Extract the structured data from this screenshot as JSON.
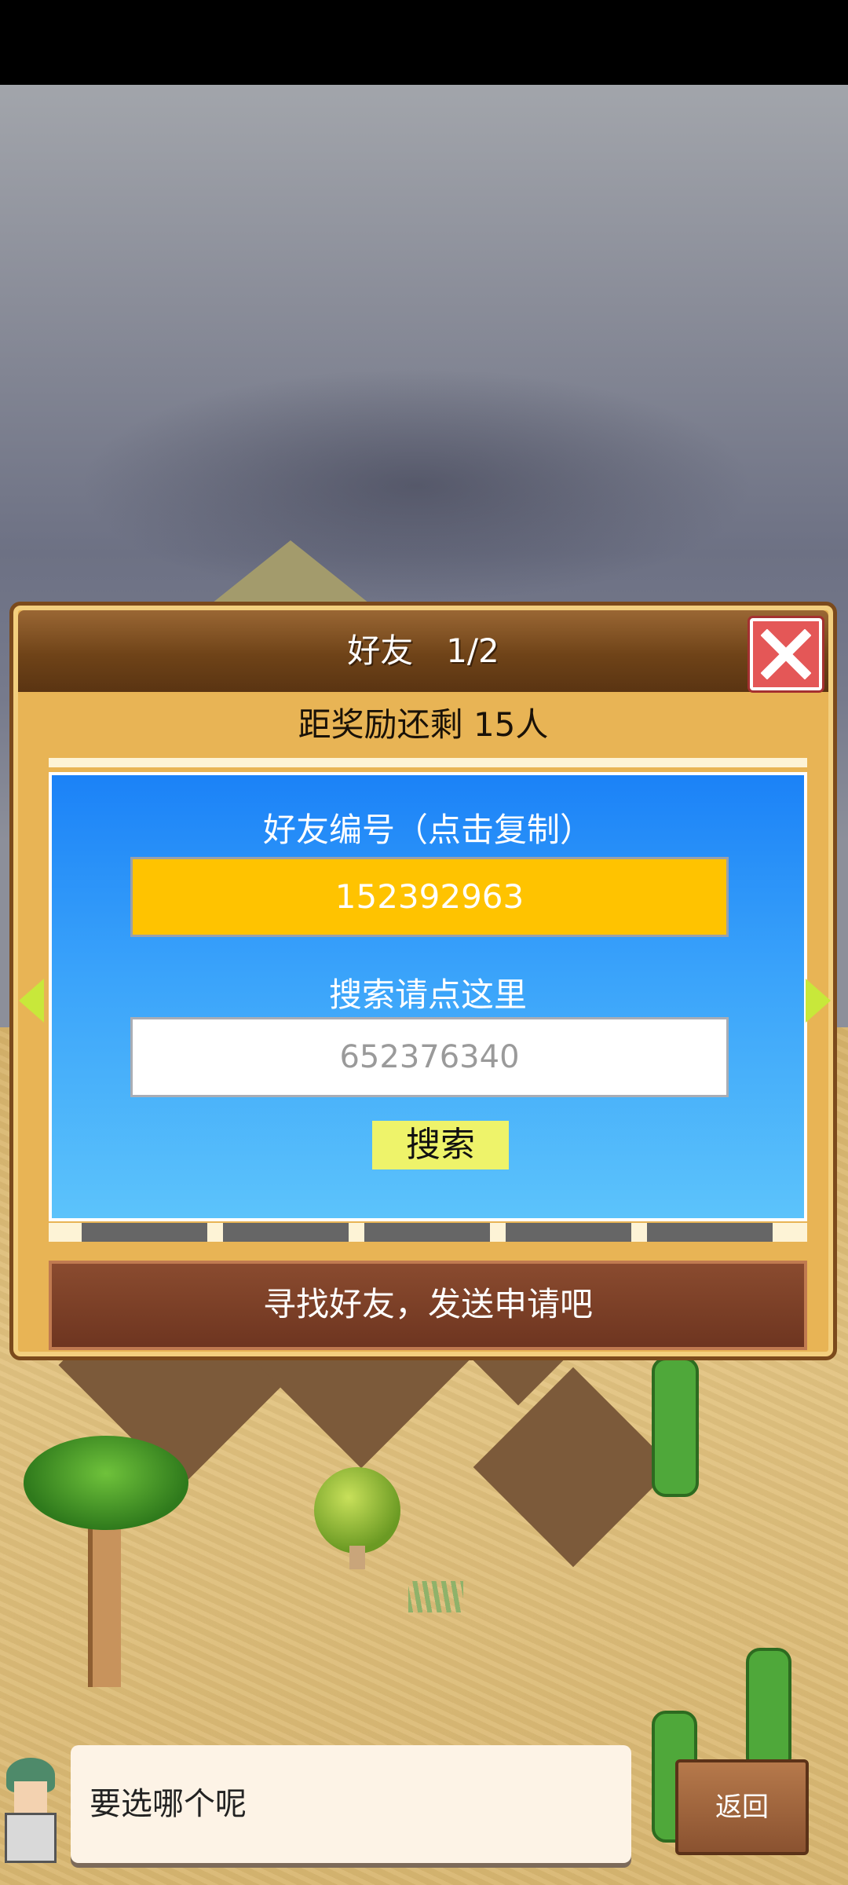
{
  "dialog": {
    "title": "好友　1/2",
    "subtitle": "距奖励还剩 15人",
    "friend_id_label": "好友编号（点击复制）",
    "friend_id": "152392963",
    "search_label": "搜索请点这里",
    "search_placeholder": "652376340",
    "search_button": "搜索",
    "find_friends_button": "寻找好友，发送申请吧"
  },
  "bottom": {
    "speech": "要选哪个呢",
    "back_button": "返回"
  },
  "colors": {
    "id_box": "#ffc300",
    "panel_top": "#1b82f7",
    "search_button": "#eef36a",
    "close_button": "#e45757"
  }
}
